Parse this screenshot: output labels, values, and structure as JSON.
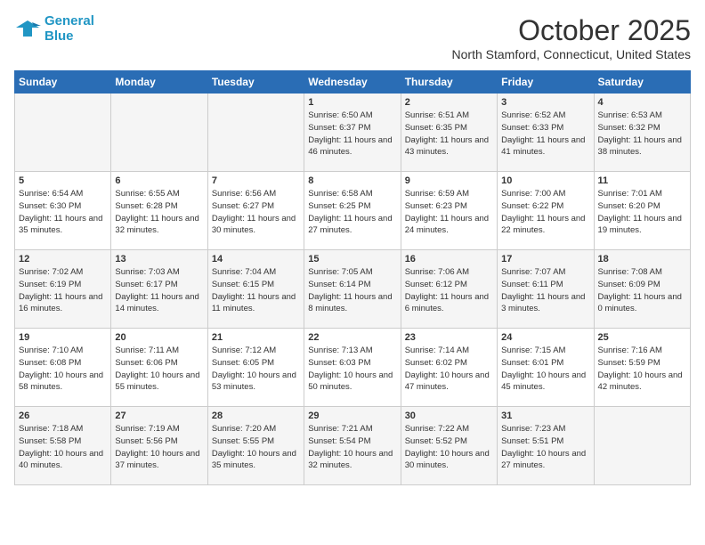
{
  "logo": {
    "line1": "General",
    "line2": "Blue"
  },
  "title": "October 2025",
  "location": "North Stamford, Connecticut, United States",
  "days_of_week": [
    "Sunday",
    "Monday",
    "Tuesday",
    "Wednesday",
    "Thursday",
    "Friday",
    "Saturday"
  ],
  "weeks": [
    [
      {
        "num": "",
        "sunrise": "",
        "sunset": "",
        "daylight": ""
      },
      {
        "num": "",
        "sunrise": "",
        "sunset": "",
        "daylight": ""
      },
      {
        "num": "",
        "sunrise": "",
        "sunset": "",
        "daylight": ""
      },
      {
        "num": "1",
        "sunrise": "Sunrise: 6:50 AM",
        "sunset": "Sunset: 6:37 PM",
        "daylight": "Daylight: 11 hours and 46 minutes."
      },
      {
        "num": "2",
        "sunrise": "Sunrise: 6:51 AM",
        "sunset": "Sunset: 6:35 PM",
        "daylight": "Daylight: 11 hours and 43 minutes."
      },
      {
        "num": "3",
        "sunrise": "Sunrise: 6:52 AM",
        "sunset": "Sunset: 6:33 PM",
        "daylight": "Daylight: 11 hours and 41 minutes."
      },
      {
        "num": "4",
        "sunrise": "Sunrise: 6:53 AM",
        "sunset": "Sunset: 6:32 PM",
        "daylight": "Daylight: 11 hours and 38 minutes."
      }
    ],
    [
      {
        "num": "5",
        "sunrise": "Sunrise: 6:54 AM",
        "sunset": "Sunset: 6:30 PM",
        "daylight": "Daylight: 11 hours and 35 minutes."
      },
      {
        "num": "6",
        "sunrise": "Sunrise: 6:55 AM",
        "sunset": "Sunset: 6:28 PM",
        "daylight": "Daylight: 11 hours and 32 minutes."
      },
      {
        "num": "7",
        "sunrise": "Sunrise: 6:56 AM",
        "sunset": "Sunset: 6:27 PM",
        "daylight": "Daylight: 11 hours and 30 minutes."
      },
      {
        "num": "8",
        "sunrise": "Sunrise: 6:58 AM",
        "sunset": "Sunset: 6:25 PM",
        "daylight": "Daylight: 11 hours and 27 minutes."
      },
      {
        "num": "9",
        "sunrise": "Sunrise: 6:59 AM",
        "sunset": "Sunset: 6:23 PM",
        "daylight": "Daylight: 11 hours and 24 minutes."
      },
      {
        "num": "10",
        "sunrise": "Sunrise: 7:00 AM",
        "sunset": "Sunset: 6:22 PM",
        "daylight": "Daylight: 11 hours and 22 minutes."
      },
      {
        "num": "11",
        "sunrise": "Sunrise: 7:01 AM",
        "sunset": "Sunset: 6:20 PM",
        "daylight": "Daylight: 11 hours and 19 minutes."
      }
    ],
    [
      {
        "num": "12",
        "sunrise": "Sunrise: 7:02 AM",
        "sunset": "Sunset: 6:19 PM",
        "daylight": "Daylight: 11 hours and 16 minutes."
      },
      {
        "num": "13",
        "sunrise": "Sunrise: 7:03 AM",
        "sunset": "Sunset: 6:17 PM",
        "daylight": "Daylight: 11 hours and 14 minutes."
      },
      {
        "num": "14",
        "sunrise": "Sunrise: 7:04 AM",
        "sunset": "Sunset: 6:15 PM",
        "daylight": "Daylight: 11 hours and 11 minutes."
      },
      {
        "num": "15",
        "sunrise": "Sunrise: 7:05 AM",
        "sunset": "Sunset: 6:14 PM",
        "daylight": "Daylight: 11 hours and 8 minutes."
      },
      {
        "num": "16",
        "sunrise": "Sunrise: 7:06 AM",
        "sunset": "Sunset: 6:12 PM",
        "daylight": "Daylight: 11 hours and 6 minutes."
      },
      {
        "num": "17",
        "sunrise": "Sunrise: 7:07 AM",
        "sunset": "Sunset: 6:11 PM",
        "daylight": "Daylight: 11 hours and 3 minutes."
      },
      {
        "num": "18",
        "sunrise": "Sunrise: 7:08 AM",
        "sunset": "Sunset: 6:09 PM",
        "daylight": "Daylight: 11 hours and 0 minutes."
      }
    ],
    [
      {
        "num": "19",
        "sunrise": "Sunrise: 7:10 AM",
        "sunset": "Sunset: 6:08 PM",
        "daylight": "Daylight: 10 hours and 58 minutes."
      },
      {
        "num": "20",
        "sunrise": "Sunrise: 7:11 AM",
        "sunset": "Sunset: 6:06 PM",
        "daylight": "Daylight: 10 hours and 55 minutes."
      },
      {
        "num": "21",
        "sunrise": "Sunrise: 7:12 AM",
        "sunset": "Sunset: 6:05 PM",
        "daylight": "Daylight: 10 hours and 53 minutes."
      },
      {
        "num": "22",
        "sunrise": "Sunrise: 7:13 AM",
        "sunset": "Sunset: 6:03 PM",
        "daylight": "Daylight: 10 hours and 50 minutes."
      },
      {
        "num": "23",
        "sunrise": "Sunrise: 7:14 AM",
        "sunset": "Sunset: 6:02 PM",
        "daylight": "Daylight: 10 hours and 47 minutes."
      },
      {
        "num": "24",
        "sunrise": "Sunrise: 7:15 AM",
        "sunset": "Sunset: 6:01 PM",
        "daylight": "Daylight: 10 hours and 45 minutes."
      },
      {
        "num": "25",
        "sunrise": "Sunrise: 7:16 AM",
        "sunset": "Sunset: 5:59 PM",
        "daylight": "Daylight: 10 hours and 42 minutes."
      }
    ],
    [
      {
        "num": "26",
        "sunrise": "Sunrise: 7:18 AM",
        "sunset": "Sunset: 5:58 PM",
        "daylight": "Daylight: 10 hours and 40 minutes."
      },
      {
        "num": "27",
        "sunrise": "Sunrise: 7:19 AM",
        "sunset": "Sunset: 5:56 PM",
        "daylight": "Daylight: 10 hours and 37 minutes."
      },
      {
        "num": "28",
        "sunrise": "Sunrise: 7:20 AM",
        "sunset": "Sunset: 5:55 PM",
        "daylight": "Daylight: 10 hours and 35 minutes."
      },
      {
        "num": "29",
        "sunrise": "Sunrise: 7:21 AM",
        "sunset": "Sunset: 5:54 PM",
        "daylight": "Daylight: 10 hours and 32 minutes."
      },
      {
        "num": "30",
        "sunrise": "Sunrise: 7:22 AM",
        "sunset": "Sunset: 5:52 PM",
        "daylight": "Daylight: 10 hours and 30 minutes."
      },
      {
        "num": "31",
        "sunrise": "Sunrise: 7:23 AM",
        "sunset": "Sunset: 5:51 PM",
        "daylight": "Daylight: 10 hours and 27 minutes."
      },
      {
        "num": "",
        "sunrise": "",
        "sunset": "",
        "daylight": ""
      }
    ]
  ]
}
